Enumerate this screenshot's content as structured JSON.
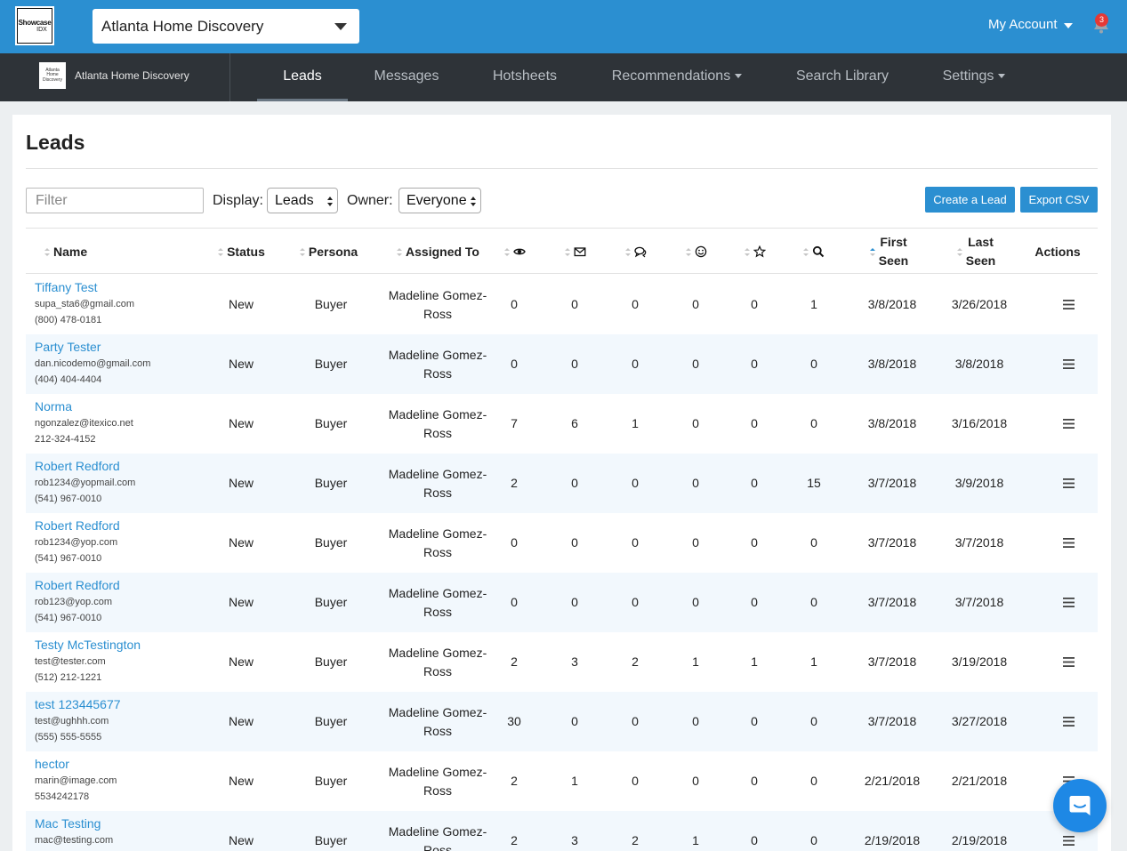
{
  "topbar": {
    "logo_line1": "Showcase",
    "logo_line2": "IDX",
    "site_selector": "Atlanta Home Discovery",
    "account_label": "My Account",
    "notification_count": "3"
  },
  "nav": {
    "brand_logo_text": "Atlanta Home Discovery",
    "brand_name": "Atlanta Home Discovery",
    "items": [
      {
        "label": "Leads"
      },
      {
        "label": "Messages"
      },
      {
        "label": "Hotsheets"
      },
      {
        "label": "Recommendations"
      },
      {
        "label": "Search Library"
      },
      {
        "label": "Settings"
      }
    ]
  },
  "page": {
    "title": "Leads",
    "filter_placeholder": "Filter",
    "display_label": "Display:",
    "display_value": "Leads",
    "owner_label": "Owner:",
    "owner_value": "Everyone",
    "create_button": "Create a Lead",
    "export_button": "Export CSV"
  },
  "table": {
    "headers": {
      "name": "Name",
      "status": "Status",
      "persona": "Persona",
      "assigned": "Assigned To",
      "first_seen_1": "First",
      "first_seen_2": "Seen",
      "last_seen_1": "Last",
      "last_seen_2": "Seen",
      "actions": "Actions"
    },
    "icon_columns": [
      "eye-icon",
      "envelope-icon",
      "chat-icon",
      "smiley-icon",
      "star-icon",
      "search-icon"
    ],
    "rows": [
      {
        "name": "Tiffany Test",
        "email": "supa_sta6@gmail.com",
        "phone": "(800) 478-0181",
        "status": "New",
        "persona": "Buyer",
        "assigned1": "Madeline Gomez-",
        "assigned2": "Ross",
        "views": "0",
        "emails": "0",
        "chats": "0",
        "smiles": "0",
        "stars": "0",
        "searches": "1",
        "first": "3/8/2018",
        "last": "3/26/2018"
      },
      {
        "name": "Party Tester",
        "email": "dan.nicodemo@gmail.com",
        "phone": "(404) 404-4404",
        "status": "New",
        "persona": "Buyer",
        "assigned1": "Madeline Gomez-",
        "assigned2": "Ross",
        "views": "0",
        "emails": "0",
        "chats": "0",
        "smiles": "0",
        "stars": "0",
        "searches": "0",
        "first": "3/8/2018",
        "last": "3/8/2018"
      },
      {
        "name": "Norma",
        "email": "ngonzalez@itexico.net",
        "phone": "212-324-4152",
        "status": "New",
        "persona": "Buyer",
        "assigned1": "Madeline Gomez-",
        "assigned2": "Ross",
        "views": "7",
        "emails": "6",
        "chats": "1",
        "smiles": "0",
        "stars": "0",
        "searches": "0",
        "first": "3/8/2018",
        "last": "3/16/2018"
      },
      {
        "name": "Robert Redford",
        "email": "rob1234@yopmail.com",
        "phone": "(541) 967-0010",
        "status": "New",
        "persona": "Buyer",
        "assigned1": "Madeline Gomez-",
        "assigned2": "Ross",
        "views": "2",
        "emails": "0",
        "chats": "0",
        "smiles": "0",
        "stars": "0",
        "searches": "15",
        "first": "3/7/2018",
        "last": "3/9/2018"
      },
      {
        "name": "Robert Redford",
        "email": "rob1234@yop.com",
        "phone": "(541) 967-0010",
        "status": "New",
        "persona": "Buyer",
        "assigned1": "Madeline Gomez-",
        "assigned2": "Ross",
        "views": "0",
        "emails": "0",
        "chats": "0",
        "smiles": "0",
        "stars": "0",
        "searches": "0",
        "first": "3/7/2018",
        "last": "3/7/2018"
      },
      {
        "name": "Robert Redford",
        "email": "rob123@yop.com",
        "phone": "(541) 967-0010",
        "status": "New",
        "persona": "Buyer",
        "assigned1": "Madeline Gomez-",
        "assigned2": "Ross",
        "views": "0",
        "emails": "0",
        "chats": "0",
        "smiles": "0",
        "stars": "0",
        "searches": "0",
        "first": "3/7/2018",
        "last": "3/7/2018"
      },
      {
        "name": "Testy McTestington",
        "email": "test@tester.com",
        "phone": "(512) 212-1221",
        "status": "New",
        "persona": "Buyer",
        "assigned1": "Madeline Gomez-",
        "assigned2": "Ross",
        "views": "2",
        "emails": "3",
        "chats": "2",
        "smiles": "1",
        "stars": "1",
        "searches": "1",
        "first": "3/7/2018",
        "last": "3/19/2018"
      },
      {
        "name": "test 123445677",
        "email": "test@ughhh.com",
        "phone": "(555) 555-5555",
        "status": "New",
        "persona": "Buyer",
        "assigned1": "Madeline Gomez-",
        "assigned2": "Ross",
        "views": "30",
        "emails": "0",
        "chats": "0",
        "smiles": "0",
        "stars": "0",
        "searches": "0",
        "first": "3/7/2018",
        "last": "3/27/2018"
      },
      {
        "name": "hector",
        "email": "marin@image.com",
        "phone": "5534242178",
        "status": "New",
        "persona": "Buyer",
        "assigned1": "Madeline Gomez-",
        "assigned2": "Ross",
        "views": "2",
        "emails": "1",
        "chats": "0",
        "smiles": "0",
        "stars": "0",
        "searches": "0",
        "first": "2/21/2018",
        "last": "2/21/2018"
      },
      {
        "name": "Mac Testing",
        "email": "mac@testing.com",
        "phone": "",
        "status": "New",
        "persona": "Buyer",
        "assigned1": "Madeline Gomez-",
        "assigned2": "Ross",
        "views": "2",
        "emails": "3",
        "chats": "2",
        "smiles": "1",
        "stars": "0",
        "searches": "0",
        "first": "2/19/2018",
        "last": "2/19/2018"
      }
    ]
  },
  "colors": {
    "topbar": "#2b8fd1",
    "navbar": "#2e3338",
    "link": "#2b8fd1",
    "row_alt": "#f2f8fd",
    "badge": "#e53935"
  }
}
